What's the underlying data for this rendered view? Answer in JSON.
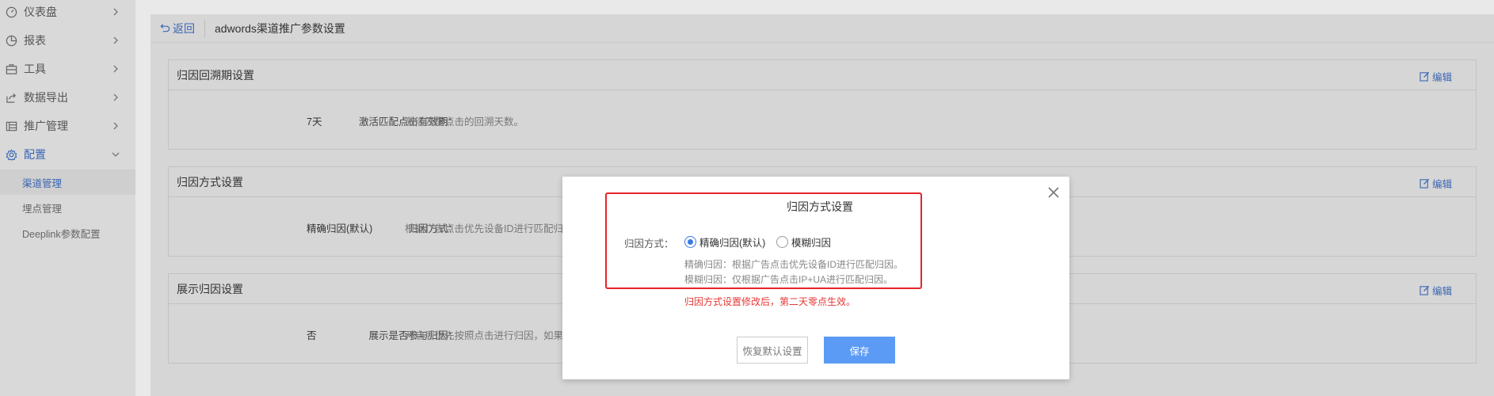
{
  "sidebar": {
    "items": [
      {
        "label": "仪表盘",
        "icon": "dashboard-icon"
      },
      {
        "label": "报表",
        "icon": "pie-chart-icon"
      },
      {
        "label": "工具",
        "icon": "toolbox-icon"
      },
      {
        "label": "数据导出",
        "icon": "export-icon"
      },
      {
        "label": "推广管理",
        "icon": "list-icon"
      },
      {
        "label": "配置",
        "icon": "gear-icon"
      }
    ],
    "sub_items": [
      {
        "label": "渠道管理"
      },
      {
        "label": "埋点管理"
      },
      {
        "label": "Deeplink参数配置"
      }
    ]
  },
  "topbar": {
    "back_label": "返回",
    "title": "adwords渠道推广参数设置"
  },
  "sections": [
    {
      "title": "归因回溯期设置",
      "edit_label": "编辑",
      "label": "激活匹配点击有效期：",
      "value": "7天",
      "desc": "激活匹配点击的回溯天数。"
    },
    {
      "title": "归因方式设置",
      "edit_label": "编辑",
      "label": "归因方式：",
      "value": "精确归因(默认)",
      "desc": "根据广告点击优先设备ID进行匹配归因"
    },
    {
      "title": "展示归因设置",
      "edit_label": "编辑",
      "label": "展示是否参与归因：",
      "value": "否",
      "desc": "开启后优先按照点击进行归因，如果没"
    }
  ],
  "modal": {
    "title": "归因方式设置",
    "field_label": "归因方式：",
    "option_exact": "精确归因(默认)",
    "option_fuzzy": "模糊归因",
    "selected": "精确归因(默认)",
    "hint_exact": "精确归因：根据广告点击优先设备ID进行匹配归因。",
    "hint_fuzzy": "模糊归因：仅根据广告点击IP+UA进行匹配归因。",
    "warning": "归因方式设置修改后，第二天零点生效。",
    "reset_label": "恢复默认设置",
    "save_label": "保存"
  },
  "colors": {
    "accent": "#3a66b4",
    "primary_button": "#5b9bf5",
    "warning": "#e53935",
    "highlight_box": "#e8232a"
  }
}
